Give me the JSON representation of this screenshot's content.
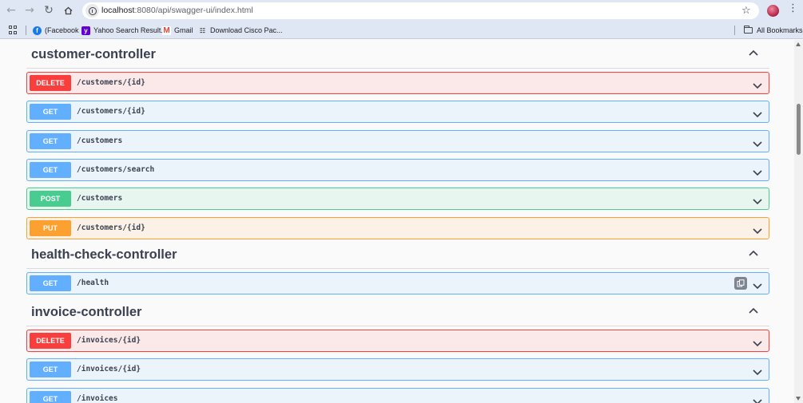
{
  "browser": {
    "url_host": "localhost",
    "url_rest": ":8080/api/swagger-ui/index.html",
    "bookmarks": [
      {
        "label": "(Facebook",
        "icon": "facebook-icon"
      },
      {
        "label": "Yahoo Search Result...",
        "icon": "yahoo-icon"
      },
      {
        "label": "Gmail",
        "icon": "gmail-icon"
      },
      {
        "label": "Download Cisco Pac...",
        "icon": "network-icon"
      }
    ],
    "all_bookmarks": "All Bookmarks"
  },
  "method_colors": {
    "DELETE": "#f93e3e",
    "GET": "#61affe",
    "POST": "#49cc90",
    "PUT": "#fca130"
  },
  "controllers": [
    {
      "name": "customer-controller",
      "operations": [
        {
          "method": "DELETE",
          "path": "/customers/{id}"
        },
        {
          "method": "GET",
          "path": "/customers/{id}"
        },
        {
          "method": "GET",
          "path": "/customers"
        },
        {
          "method": "GET",
          "path": "/customers/search"
        },
        {
          "method": "POST",
          "path": "/customers"
        },
        {
          "method": "PUT",
          "path": "/customers/{id}"
        }
      ]
    },
    {
      "name": "health-check-controller",
      "operations": [
        {
          "method": "GET",
          "path": "/health",
          "show_copy": true
        }
      ]
    },
    {
      "name": "invoice-controller",
      "operations": [
        {
          "method": "DELETE",
          "path": "/invoices/{id}"
        },
        {
          "method": "GET",
          "path": "/invoices/{id}"
        },
        {
          "method": "GET",
          "path": "/invoices"
        }
      ]
    }
  ]
}
